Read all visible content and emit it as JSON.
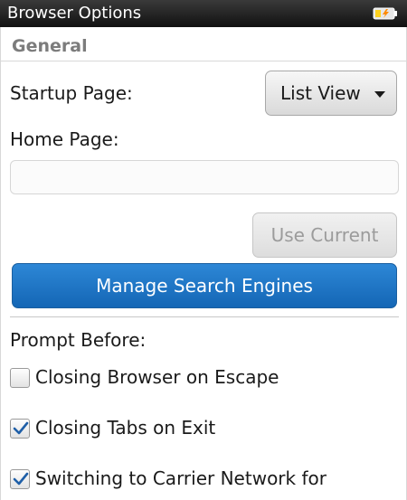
{
  "window": {
    "title": "Browser Options",
    "battery_icon": "battery-charging-icon"
  },
  "general": {
    "header": "General",
    "startup_page_label": "Startup Page:",
    "startup_page_value": "List View",
    "home_page_label": "Home Page:",
    "home_page_value": "",
    "use_current_label": "Use Current",
    "manage_search_engines_label": "Manage Search Engines"
  },
  "prompt_before": {
    "label": "Prompt Before:",
    "items": [
      {
        "label": "Closing Browser on Escape",
        "checked": false
      },
      {
        "label": "Closing Tabs on Exit",
        "checked": true
      },
      {
        "label": "Switching to Carrier Network for",
        "checked": true
      }
    ]
  },
  "colors": {
    "title_bar": "#1a1a1a",
    "accent_button": "#1f74c4",
    "section_header": "#7c7c7c",
    "check_mark": "#1f5fa8"
  }
}
